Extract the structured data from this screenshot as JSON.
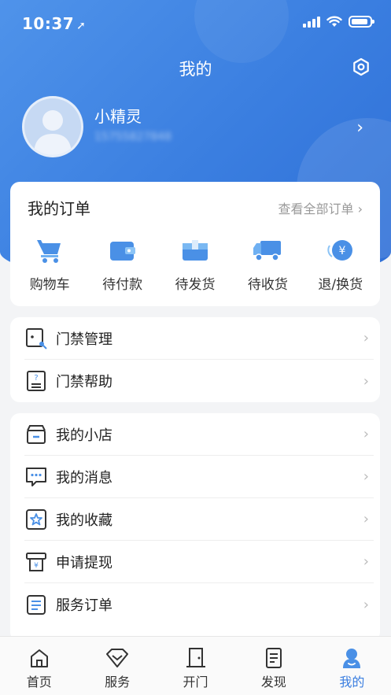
{
  "status_bar": {
    "time": "10:37",
    "location_glyph": "➚"
  },
  "header": {
    "title": "我的",
    "settings_icon": "settings-hexagon-icon"
  },
  "profile": {
    "name": "小精灵",
    "phone": "15755827848",
    "arrow": "›"
  },
  "orders": {
    "title": "我的订单",
    "view_all": "查看全部订单 ›",
    "items": [
      {
        "label": "购物车",
        "icon": "shopping-cart-icon"
      },
      {
        "label": "待付款",
        "icon": "wallet-icon"
      },
      {
        "label": "待发货",
        "icon": "package-icon"
      },
      {
        "label": "待收货",
        "icon": "delivery-truck-icon"
      },
      {
        "label": "退/换货",
        "icon": "refund-icon"
      }
    ]
  },
  "access": {
    "items": [
      {
        "label": "门禁管理",
        "icon": "access-control-icon"
      },
      {
        "label": "门禁帮助",
        "icon": "help-document-icon"
      }
    ]
  },
  "menu": {
    "items": [
      {
        "label": "我的小店",
        "icon": "shop-icon"
      },
      {
        "label": "我的消息",
        "icon": "message-icon"
      },
      {
        "label": "我的收藏",
        "icon": "favorite-star-icon"
      },
      {
        "label": "申请提现",
        "icon": "withdraw-icon"
      },
      {
        "label": "服务订单",
        "icon": "service-order-icon"
      }
    ]
  },
  "tabbar": {
    "items": [
      {
        "label": "首页",
        "icon": "home-icon"
      },
      {
        "label": "服务",
        "icon": "diamond-icon"
      },
      {
        "label": "开门",
        "icon": "door-icon"
      },
      {
        "label": "发现",
        "icon": "discover-document-icon"
      },
      {
        "label": "我的",
        "icon": "user-icon",
        "active": true
      }
    ]
  },
  "colors": {
    "primary": "#3a7ee0",
    "accent_light": "#5aa8f0",
    "background": "#f3f4f6"
  }
}
